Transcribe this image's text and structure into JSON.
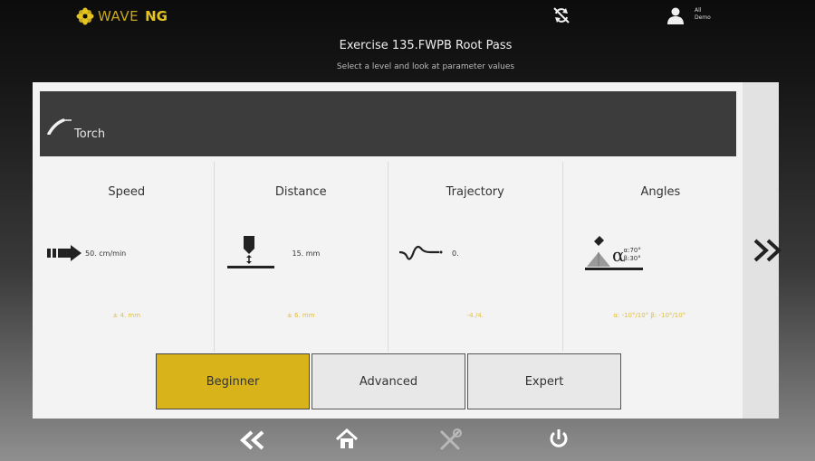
{
  "header": {
    "logo_wave": "WAVE",
    "logo_ng": "NG",
    "user_line1": "All",
    "user_line2": "Demo",
    "title": "Exercise 135.FWPB Root Pass",
    "subtitle": "Select a level and look at parameter values"
  },
  "section": {
    "label": "Torch"
  },
  "params": [
    {
      "title": "Speed",
      "value": "50. cm/min",
      "range": "± 4. mm"
    },
    {
      "title": "Distance",
      "value": "15. mm",
      "range": "± 6. mm"
    },
    {
      "title": "Trajectory",
      "value": "0.",
      "range": "-4./4."
    },
    {
      "title": "Angles",
      "alpha": "α:70°",
      "beta": "β:30°",
      "range": "α: -10°/10° β: -10°/10°"
    }
  ],
  "levels": [
    {
      "label": "Beginner",
      "active": true
    },
    {
      "label": "Advanced",
      "active": false
    },
    {
      "label": "Expert",
      "active": false
    }
  ],
  "nav": {
    "next": "»",
    "back": "«"
  },
  "colors": {
    "accent": "#d9b31a",
    "range_text": "#e2bf3a",
    "panel": "#f3f3f3",
    "header_bar": "#3c3c3c"
  },
  "icons": [
    "flower-logo-icon",
    "sync-off-icon",
    "user-icon",
    "torch-icon",
    "speed-arrow-icon",
    "distance-icon",
    "trajectory-icon",
    "angle-icon",
    "double-chevron-right-icon",
    "double-chevron-left-icon",
    "home-icon",
    "tools-icon",
    "power-icon"
  ]
}
